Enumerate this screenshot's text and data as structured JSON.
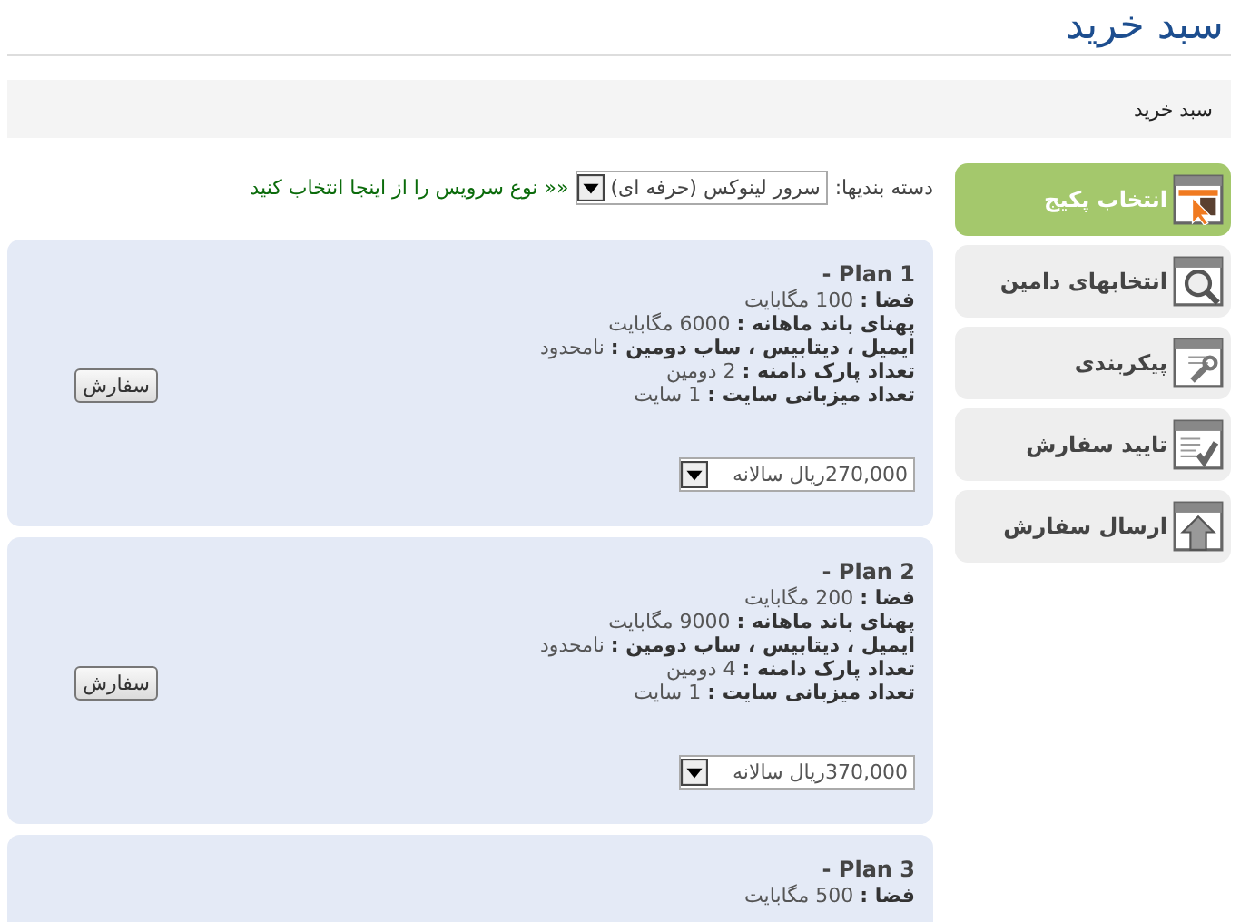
{
  "page_title": "سبد خرید",
  "breadcrumb": "سبد خرید",
  "category": {
    "label": "دسته بندیها:",
    "value": "سرور لینوکس (حرفه ای)",
    "hint": "«« نوع سرویس را از اینجا انتخاب کنید"
  },
  "steps": [
    {
      "label": "انتخاب پکیج",
      "kind": "pointer",
      "selected": true
    },
    {
      "label": "انتخابهای دامین",
      "kind": "search",
      "selected": false
    },
    {
      "label": "پیکربندی",
      "kind": "wrench",
      "selected": false
    },
    {
      "label": "تایید سفارش",
      "kind": "check",
      "selected": false
    },
    {
      "label": "ارسال سفارش",
      "kind": "upload",
      "selected": false
    }
  ],
  "plans": [
    {
      "title": "Plan 1 -",
      "features": [
        "**فضا :** 100 مگابایت",
        "**پهنای باند ماهانه :** 6000 مگابایت",
        "**ایمیل ، دیتابیس ، ساب دومین :** نامحدود",
        "**تعداد پارک دامنه :** 2 دومین",
        "**تعداد میزبانی سایت :** 1 سایت"
      ],
      "price": "270,000ریال سالانه",
      "button": "سفارش"
    },
    {
      "title": "Plan 2 -",
      "features": [
        "**فضا :** 200 مگابایت",
        "**پهنای باند ماهانه :** 9000 مگابایت",
        "**ایمیل ، دیتابیس ، ساب دومین :** نامحدود",
        "**تعداد پارک دامنه :** 4 دومین",
        "**تعداد میزبانی سایت :** 1 سایت"
      ],
      "price": "370,000ریال سالانه",
      "button": "سفارش"
    },
    {
      "title": "Plan 3 -",
      "features": [
        "**فضا :** 500 مگابایت"
      ]
    }
  ]
}
